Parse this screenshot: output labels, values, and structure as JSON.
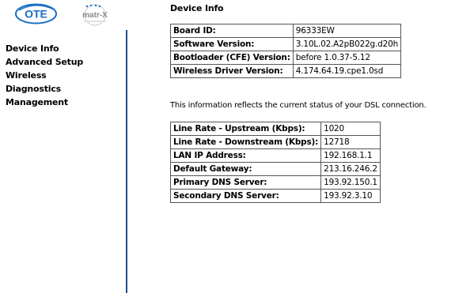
{
  "logos": {
    "brand": "OTE",
    "product": "matr-X"
  },
  "menu": [
    "Device Info",
    "Advanced Setup",
    "Wireless",
    "Diagnostics",
    "Management"
  ],
  "page": {
    "title": "Device Info",
    "note": "This information reflects the current status of your DSL connection."
  },
  "device_table": [
    {
      "label": "Board ID:",
      "value": "96333EW"
    },
    {
      "label": "Software Version:",
      "value": "3.10L.02.A2pB022g.d20h"
    },
    {
      "label": "Bootloader (CFE) Version:",
      "value": "before 1.0.37-5.12"
    },
    {
      "label": "Wireless Driver Version:",
      "value": "4.174.64.19.cpe1.0sd"
    }
  ],
  "status_table": [
    {
      "label": "Line Rate - Upstream (Kbps):",
      "value": "1020"
    },
    {
      "label": "Line Rate - Downstream (Kbps):",
      "value": "12718"
    },
    {
      "label": "LAN IP Address:",
      "value": "192.168.1.1"
    },
    {
      "label": "Default Gateway:",
      "value": "213.16.246.2"
    },
    {
      "label": "Primary DNS Server:",
      "value": "193.92.150.1"
    },
    {
      "label": "Secondary DNS Server:",
      "value": "193.92.3.10"
    }
  ],
  "colors": {
    "sidebar_border": "#1f4e8a",
    "ote_blue": "#1a6fc4",
    "matrx_gray": "#8a8a8a"
  }
}
